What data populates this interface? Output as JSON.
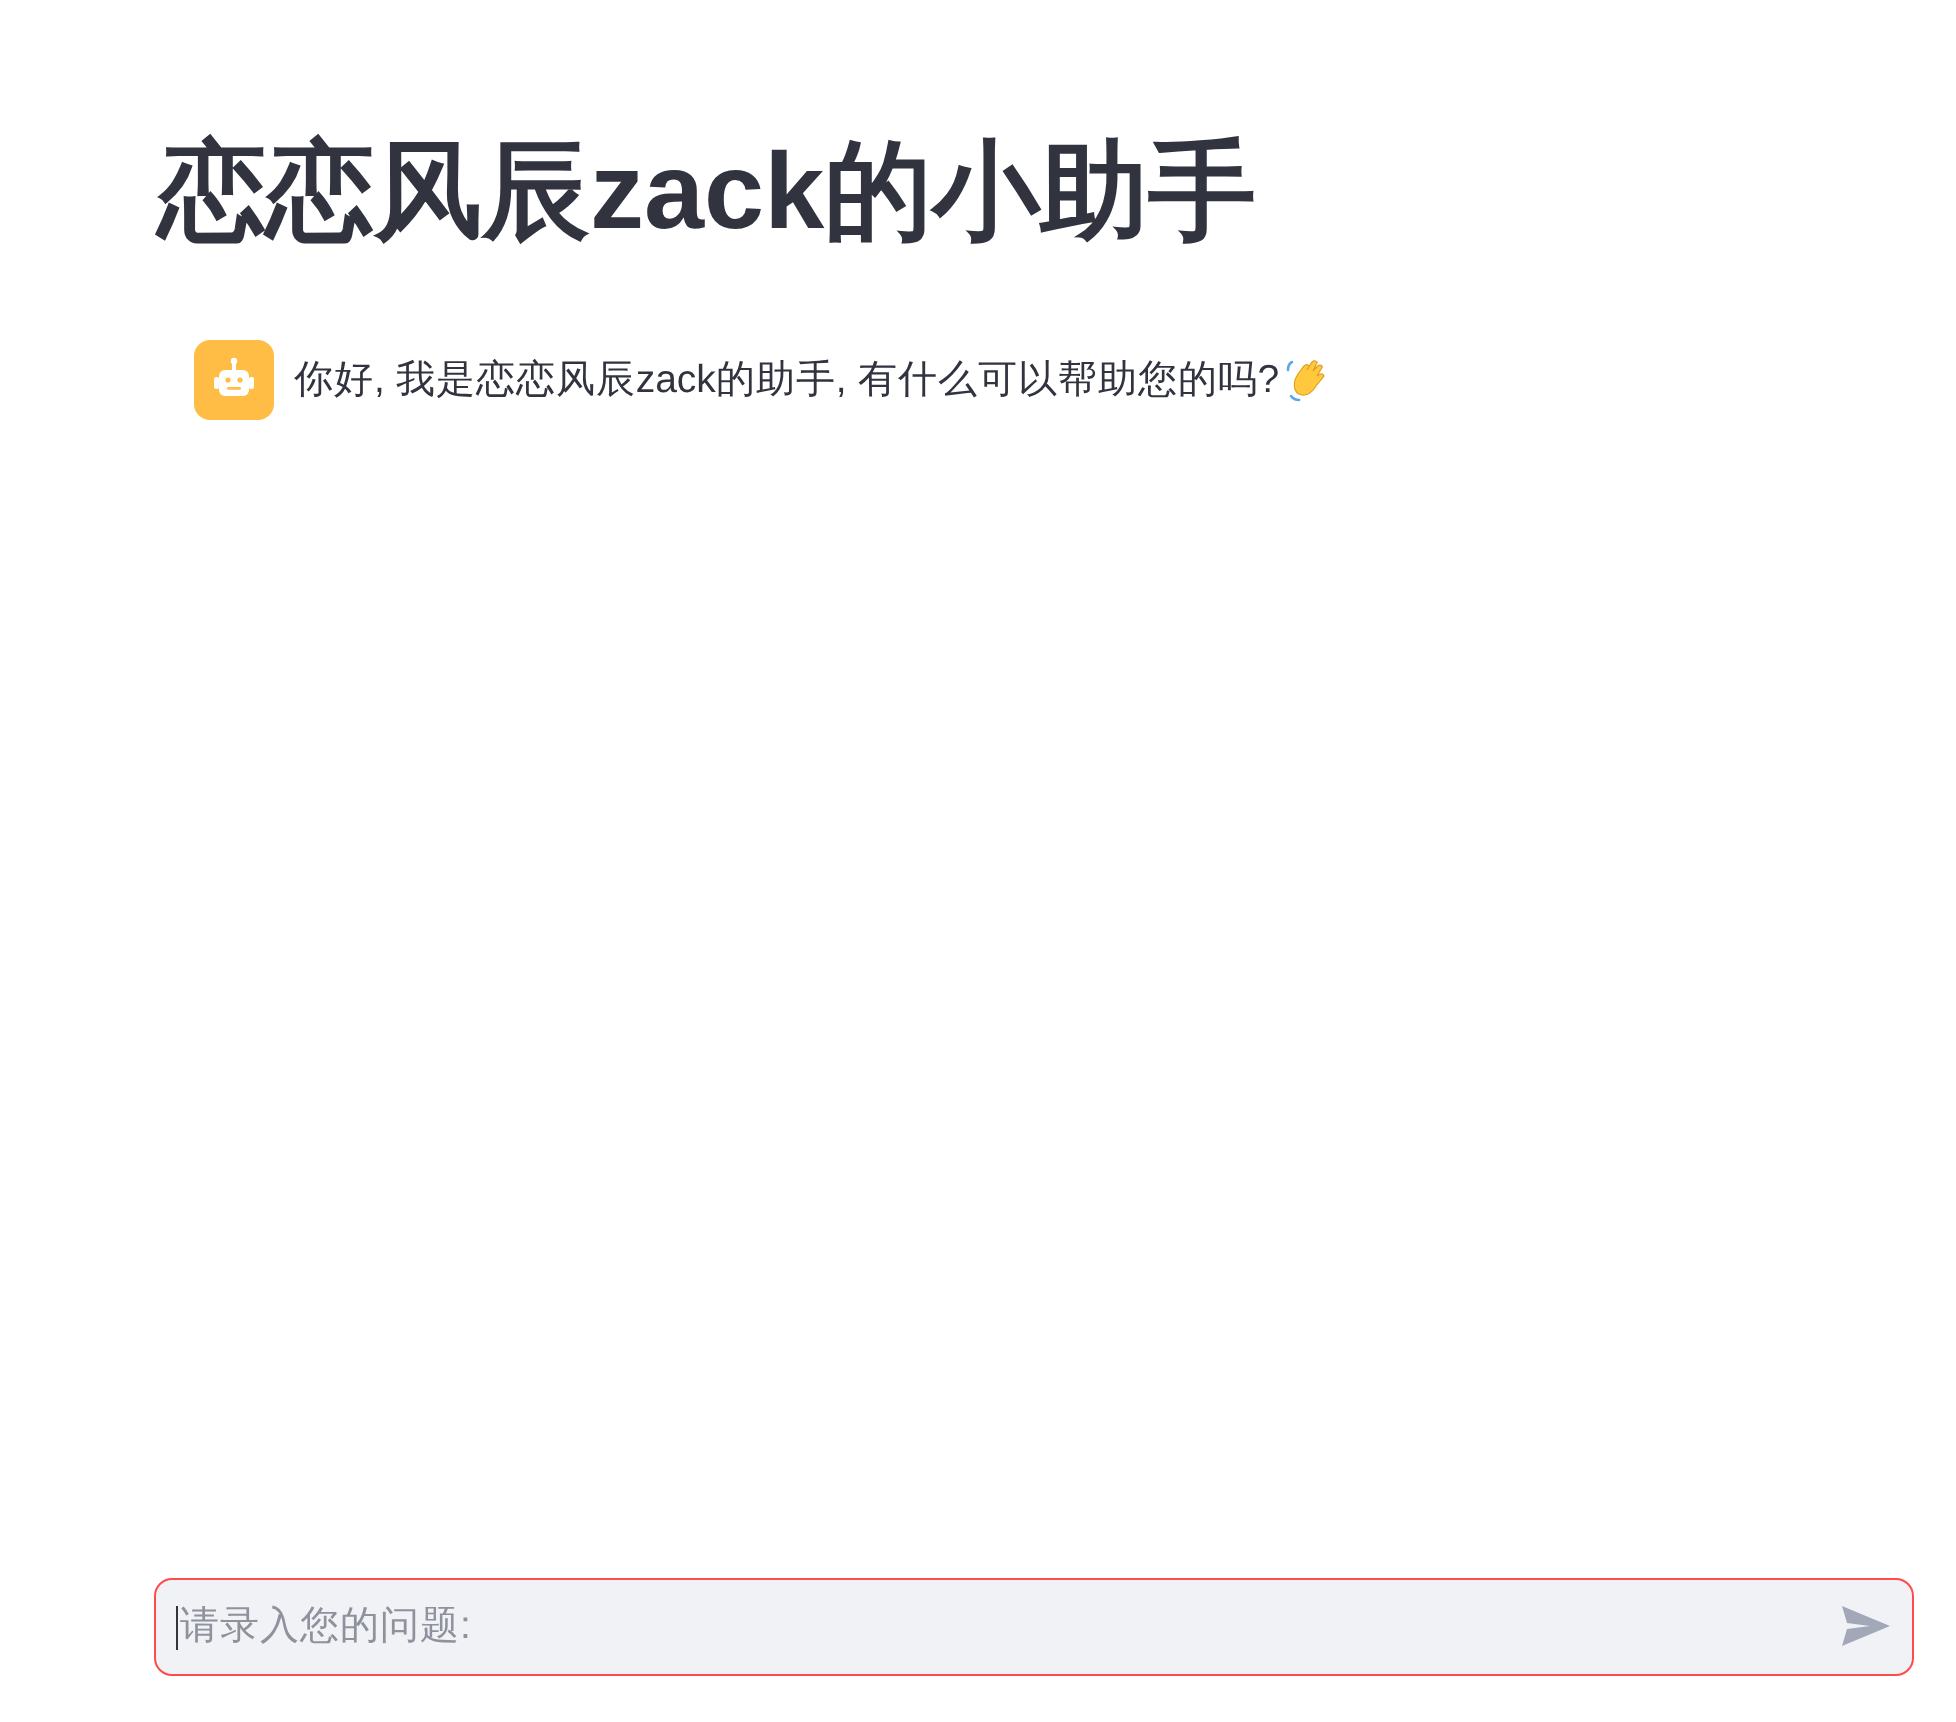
{
  "title": "恋恋风辰zack的小助手",
  "messages": [
    {
      "kind": "assistant",
      "text": "你好, 我是恋恋风辰zack的助手, 有什么可以帮助您的吗?"
    }
  ],
  "chat_input": {
    "placeholder": "请录入您的问题:",
    "focused": true
  }
}
